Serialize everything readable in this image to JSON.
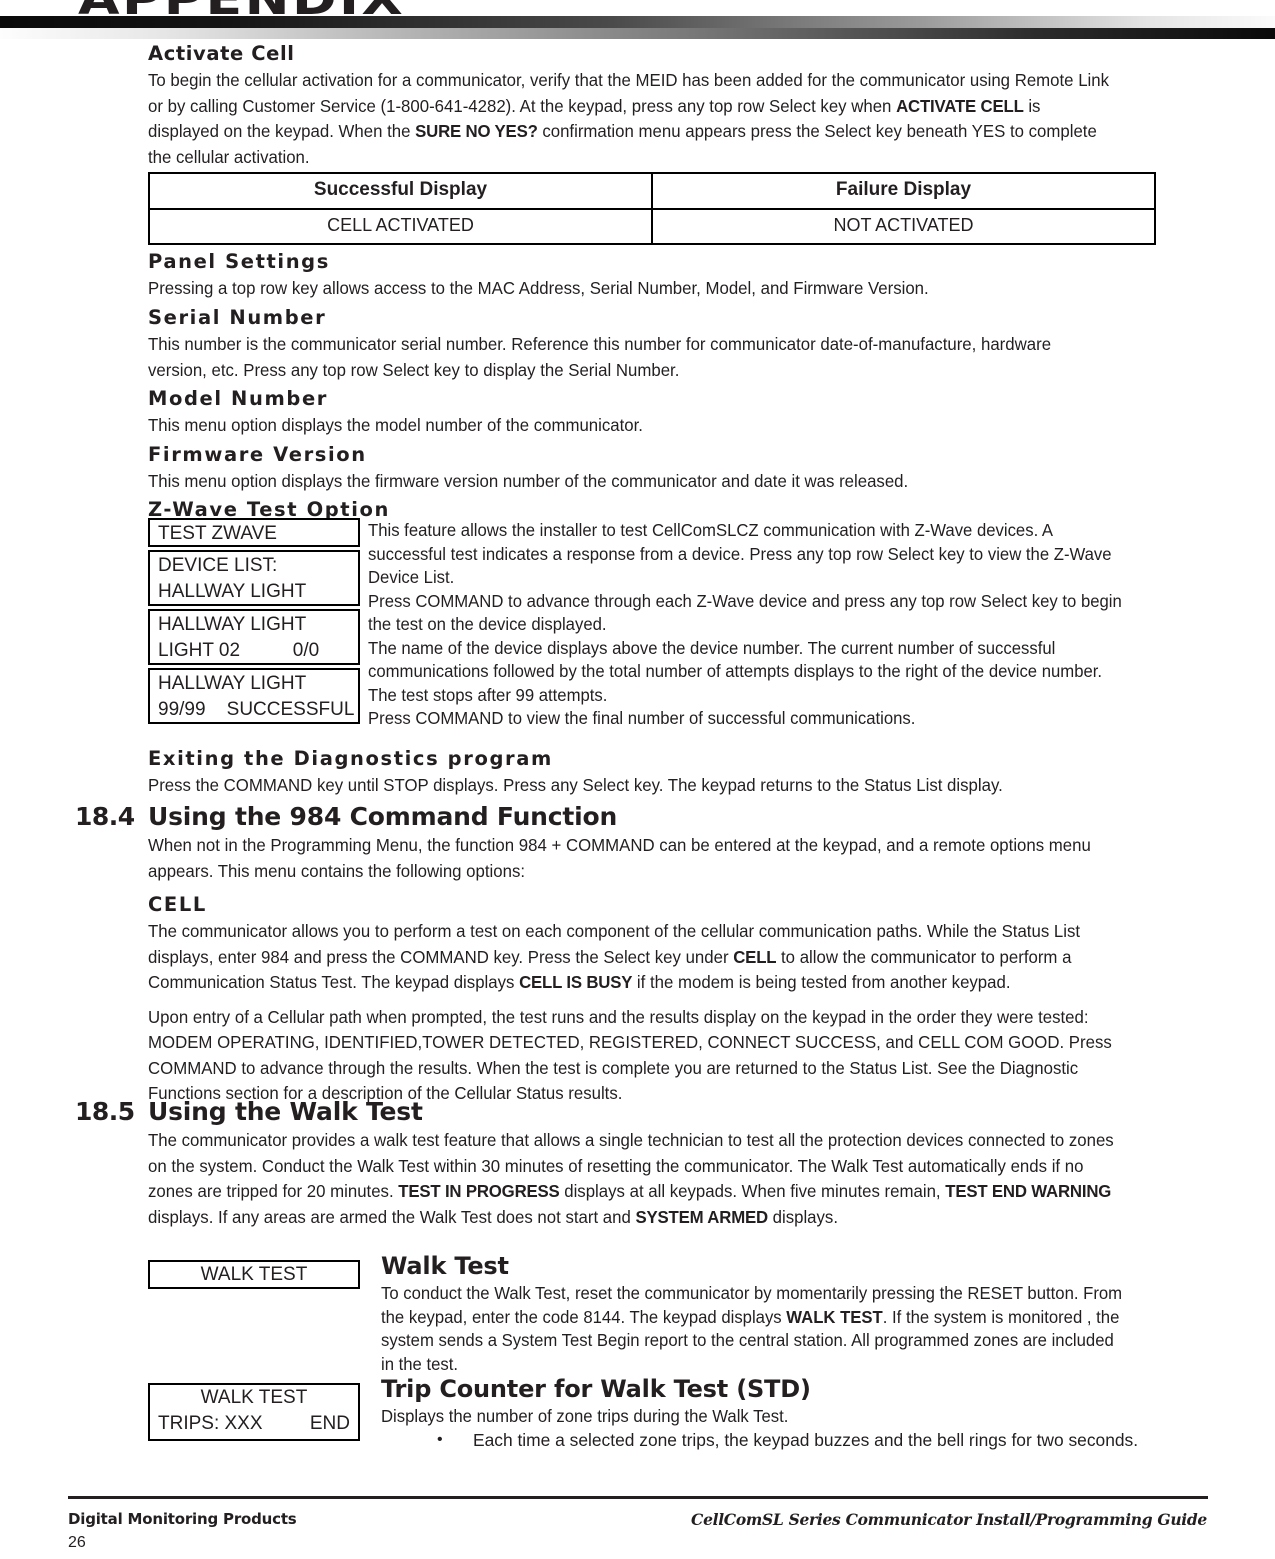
{
  "header": {
    "title": "APPENDIX"
  },
  "sections": {
    "activate_cell": {
      "heading": "Activate Cell",
      "paragraph_parts": [
        {
          "text": "To begin the cellular activation for a communicator, verify that the MEID has been added for the communicator using Remote Link or by calling Customer Service (1-800-641-4282). At the keypad, press any top row Select key when ",
          "bold": false
        },
        {
          "text": "ACTIVATE CELL",
          "bold": true
        },
        {
          "text": " is displayed on the keypad. When the ",
          "bold": false
        },
        {
          "text": "SURE NO YES?",
          "bold": true
        },
        {
          "text": " confirmation menu appears press the Select key beneath YES to complete the cellular activation.",
          "bold": false
        }
      ]
    },
    "display_table": {
      "headers": [
        "Successful Display",
        "Failure Display"
      ],
      "rows": [
        [
          "CELL ACTIVATED",
          "NOT ACTIVATED"
        ]
      ]
    },
    "panel_settings": {
      "heading": "Panel Settings",
      "paragraph": "Pressing a top row key allows access to the MAC Address, Serial Number, Model, and Firmware Version."
    },
    "serial_number": {
      "heading": "Serial Number",
      "paragraph": "This number is the communicator serial number. Reference this number for communicator date-of-manufacture, hardware version, etc. Press any top row Select key to display the Serial Number."
    },
    "model_number": {
      "heading": "Model Number",
      "paragraph": "This menu option displays the model number of the communicator."
    },
    "firmware_version": {
      "heading": "Firmware Version",
      "paragraph": "This menu option displays the firmware version number of the communicator and date it was released."
    },
    "zwave_test": {
      "heading": "Z-Wave Test Option",
      "keypads": [
        {
          "lines": [
            "TEST ZWAVE"
          ]
        },
        {
          "lines": [
            "DEVICE LIST:",
            "HALLWAY LIGHT"
          ]
        },
        {
          "lines": [
            "HALLWAY LIGHT",
            "LIGHT 02          0/0"
          ]
        },
        {
          "lines": [
            "HALLWAY LIGHT",
            "99/99    SUCCESSFUL"
          ]
        }
      ],
      "paragraphs": [
        " This feature allows the installer to test CellComSLCZ communication with Z-Wave devices. A successful test indicates a response from a device. Press any top row Select key to view the Z-Wave Device List.",
        "Press COMMAND to advance through each Z-Wave device and press any top row Select key to begin the test on the device displayed.",
        "The name of the device displays above the device number. The current number of successful communications followed by the total number of attempts displays to the right of the device number. The test stops after 99 attempts.",
        "Press COMMAND to view the final number of successful communications."
      ]
    },
    "exiting_diagnostics": {
      "heading": "Exiting the Diagnostics program",
      "paragraph": "Press the COMMAND key until STOP displays. Press any Select key. The keypad returns to the Status List display."
    },
    "sec_18_4": {
      "number": "18.4",
      "heading": "Using the 984 Command Function",
      "intro": "When not in the Programming Menu, the function 984 + COMMAND can be entered at the keypad, and a remote options menu appears. This menu contains the following options:",
      "cell_heading": "CELL",
      "cell_para_parts": [
        {
          "text": "The communicator allows you to perform a test on each component of the cellular communication paths. While the Status List displays, enter 984 and press the COMMAND key. Press the Select key under ",
          "bold": false
        },
        {
          "text": "CELL",
          "bold": true
        },
        {
          "text": " to allow the communicator to perform a Communication Status Test. The keypad displays ",
          "bold": false
        },
        {
          "text": "CELL IS BUSY",
          "bold": true
        },
        {
          "text": " if the modem is being tested from another keypad.",
          "bold": false
        }
      ],
      "results_para": "Upon entry of a Cellular path when prompted, the test runs and the results display on the keypad in the order they were tested: MODEM OPERATING, IDENTIFIED,TOWER DETECTED, REGISTERED, CONNECT SUCCESS, and CELL COM GOOD. Press COMMAND to advance through the results. When the test is complete you are returned to the Status List. See the Diagnostic Functions section for a description of the Cellular Status results."
    },
    "sec_18_5": {
      "number": "18.5",
      "heading": "Using the Walk Test",
      "intro_parts": [
        {
          "text": "The communicator provides a walk test feature that allows a single technician to test all the protection devices connected to zones on the system. Conduct the Walk Test within 30 minutes of resetting the communicator. The Walk Test automatically ends if no zones are tripped for 20 minutes. ",
          "bold": false
        },
        {
          "text": "TEST IN PROGRESS",
          "bold": true
        },
        {
          "text": " displays at all keypads. When five minutes remain, ",
          "bold": false
        },
        {
          "text": "TEST END WARNING",
          "bold": true
        },
        {
          "text": " displays. If any areas are armed the Walk Test does not start and ",
          "bold": false
        },
        {
          "text": "SYSTEM ARMED",
          "bold": true
        },
        {
          "text": " displays.",
          "bold": false
        }
      ],
      "walk_test": {
        "heading": "Walk Test",
        "keypad_lines": [
          "WALK TEST"
        ],
        "paragraph_parts": [
          {
            "text": "To conduct the Walk Test, reset the communicator by momentarily pressing the RESET button. From the keypad, enter the code 8144. The keypad displays ",
            "bold": false
          },
          {
            "text": "WALK TEST",
            "bold": true
          },
          {
            "text": ". If the system is monitored , the system sends a System Test Begin report to the central station. All programmed zones are included in the test.",
            "bold": false
          }
        ]
      },
      "trip_counter": {
        "heading": "Trip Counter for Walk Test (STD)",
        "keypad_line_1": "WALK TEST",
        "keypad_line_2_left": "TRIPS: XXX",
        "keypad_line_2_right": "END",
        "paragraph": "Displays the number of zone trips during the Walk Test.",
        "bullets": [
          "Each time a selected zone trips, the keypad buzzes and the bell rings for two seconds."
        ]
      }
    }
  },
  "footer": {
    "company": "Digital Monitoring Products",
    "page_number": "26",
    "guide_title": "CellComSL Series Communicator Install/Programming Guide"
  }
}
